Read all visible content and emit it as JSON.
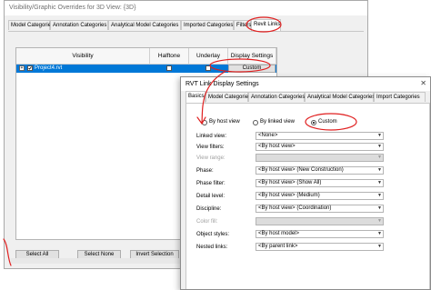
{
  "back_window": {
    "title": "Visibility/Graphic Overrides for 3D View: {3D}",
    "tabs": [
      {
        "label": "Model Categories"
      },
      {
        "label": "Annotation Categories"
      },
      {
        "label": "Analytical Model Categories"
      },
      {
        "label": "Imported Categories"
      },
      {
        "label": "Filters"
      },
      {
        "label": "Revit Links"
      }
    ],
    "active_tab": "Revit Links",
    "table": {
      "columns": [
        "Visibility",
        "Halftone",
        "Underlay",
        "Display Settings"
      ],
      "rows": [
        {
          "name": "Project4.rvt",
          "expander": "+",
          "visible": true,
          "halftone": false,
          "underlay": false,
          "display_settings": "Custom"
        }
      ]
    },
    "buttons": {
      "select_all": "Select All",
      "select_none": "Select None",
      "invert_selection": "Invert Selection"
    }
  },
  "front_window": {
    "title": "RVT Link Display Settings",
    "tabs": [
      {
        "label": "Basics"
      },
      {
        "label": "Model Categories"
      },
      {
        "label": "Annotation Categories"
      },
      {
        "label": "Analytical Model Categories"
      },
      {
        "label": "Import Categories"
      }
    ],
    "active_tab": "Basics",
    "radio": {
      "by_host": "By host view",
      "by_linked": "By linked view",
      "custom": "Custom",
      "selected": "Custom"
    },
    "settings": [
      {
        "label": "Linked view:",
        "value": "<None>",
        "enabled": true
      },
      {
        "label": "View filters:",
        "value": "<By host view>",
        "enabled": true
      },
      {
        "label": "View range:",
        "value": "",
        "enabled": false
      },
      {
        "label": "Phase:",
        "value": "<By host view> (New Construction)",
        "enabled": true
      },
      {
        "label": "Phase filter:",
        "value": "<By host view> (Show All)",
        "enabled": true
      },
      {
        "label": "Detail level:",
        "value": "<By host view> (Medium)",
        "enabled": true
      },
      {
        "label": "Discipline:",
        "value": "<By host view> (Coordination)",
        "enabled": true
      },
      {
        "label": "Color fill:",
        "value": "",
        "enabled": false
      },
      {
        "label": "Object styles:",
        "value": "<By host model>",
        "enabled": true
      },
      {
        "label": "Nested links:",
        "value": "<By parent link>",
        "enabled": true
      }
    ]
  },
  "colors": {
    "selection": "#0078d7",
    "annotation": "#e02020",
    "dialog_bg": "#f0f0f0"
  }
}
